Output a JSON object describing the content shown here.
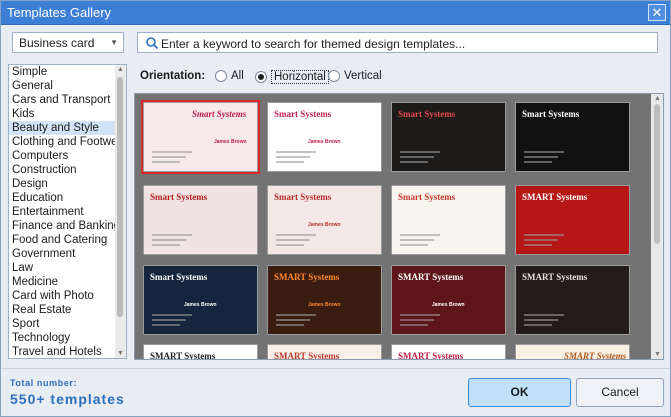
{
  "window": {
    "title": "Templates Gallery",
    "close_glyph": "✕"
  },
  "category_dropdown": {
    "value": "Business card"
  },
  "search": {
    "placeholder": "Enter a keyword to search for themed design templates..."
  },
  "categories": [
    "Simple",
    "General",
    "Cars and Transport",
    "Kids",
    "Beauty and Style",
    "Clothing and Footwear",
    "Computers",
    "Construction",
    "Design",
    "Education",
    "Entertainment",
    "Finance and Banking",
    "Food and Catering",
    "Government",
    "Law",
    "Medicine",
    "Card with Photo",
    "Real Estate",
    "Sport",
    "Technology",
    "Travel and Hotels"
  ],
  "selected_category_index": 4,
  "orientation": {
    "label": "Orientation:",
    "options": [
      "All",
      "Horizontal",
      "Vertical"
    ],
    "selected": "Horizontal"
  },
  "templates": [
    {
      "company": "Smart Systems",
      "person": "James Brown",
      "bg": "#f7e8ec",
      "accent": "#c21d4b",
      "style": "script"
    },
    {
      "company": "Smart Systems",
      "person": "James Brown",
      "bg": "#ffffff",
      "accent": "#c21d4b",
      "style": "serif"
    },
    {
      "company": "Smart Systems",
      "person": "",
      "bg": "#1d1a1a",
      "accent": "#e34b4b",
      "style": "dark"
    },
    {
      "company": "Smart Systems",
      "person": "",
      "bg": "#111111",
      "accent": "#ffffff",
      "style": "dark"
    },
    {
      "company": "Smart Systems",
      "person": "",
      "bg": "#f1e3e3",
      "accent": "#b01e1e",
      "style": "light"
    },
    {
      "company": "Smart Systems",
      "person": "James Brown",
      "bg": "#f3e8e6",
      "accent": "#b62b2b",
      "style": "light"
    },
    {
      "company": "Smart Systems",
      "person": "",
      "bg": "#f8f4ee",
      "accent": "#c0392b",
      "style": "light"
    },
    {
      "company": "SMART Systems",
      "person": "",
      "bg": "#b71616",
      "accent": "#ffffff",
      "style": "red"
    },
    {
      "company": "Smart Systems",
      "person": "James Brown",
      "bg": "#15253d",
      "accent": "#ffffff",
      "style": "dark"
    },
    {
      "company": "SMART Systems",
      "person": "James Brown",
      "bg": "#3a1c10",
      "accent": "#ff8a2a",
      "style": "dark"
    },
    {
      "company": "SMART Systems",
      "person": "James Brown",
      "bg": "#5e1519",
      "accent": "#ffffff",
      "style": "dark"
    },
    {
      "company": "SMART Systems",
      "person": "",
      "bg": "#241b1b",
      "accent": "#e6dede",
      "style": "dark"
    },
    {
      "company": "SMART Systems",
      "person": "",
      "bg": "#ffffff",
      "accent": "#222222",
      "style": "light"
    },
    {
      "company": "SMART Systems",
      "person": "",
      "bg": "#f7efe8",
      "accent": "#c0392b",
      "style": "light"
    },
    {
      "company": "SMART Systems",
      "person": "",
      "bg": "#ffffff",
      "accent": "#c21d4b",
      "style": "light"
    },
    {
      "company": "SMART Systems",
      "person": "",
      "bg": "#f8f0e2",
      "accent": "#b55a1e",
      "style": "script"
    }
  ],
  "selected_template_index": 0,
  "footer": {
    "total_label": "Total number:",
    "total_value": "550+ templates",
    "ok_label": "OK",
    "cancel_label": "Cancel"
  },
  "colors": {
    "titlebar": "#3b7fd6",
    "accent_text": "#2d6fbf",
    "ok_bg": "#bfe0f7"
  }
}
